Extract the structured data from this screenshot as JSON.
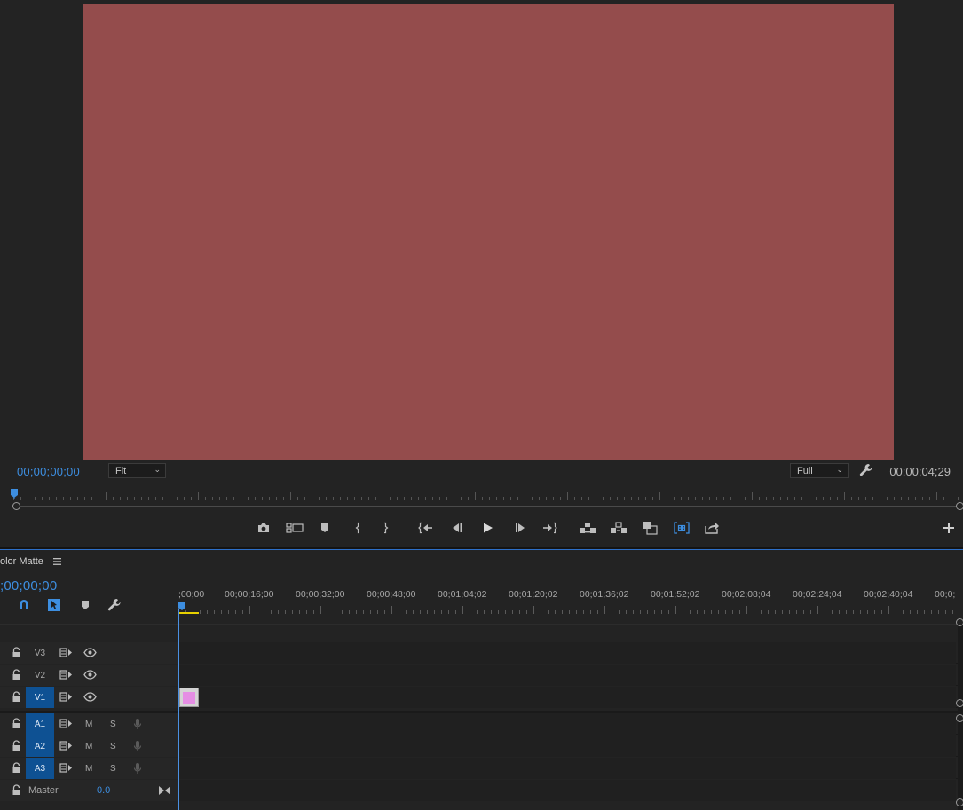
{
  "colors": {
    "accent": "#3d8ee0",
    "video_frame": "#944c4c",
    "track_target": "#0e5193",
    "clip_thumbnail": "#e58ee4",
    "work_area": "#e7d000"
  },
  "program_monitor": {
    "current_timecode": "00;00;00;00",
    "duration_timecode": "00;00;04;29",
    "zoom_level": "Fit",
    "playback_resolution": "Full",
    "transport_buttons": [
      "camera-icon",
      "multicam-icon",
      "marker-icon",
      "mark-in-icon",
      "mark-out-icon",
      "go-to-in-icon",
      "step-back-icon",
      "play-icon",
      "step-forward-icon",
      "go-to-out-icon",
      "lift-icon",
      "extract-icon",
      "comparison-view-icon",
      "trim-icon",
      "export-frame-icon"
    ]
  },
  "timeline": {
    "sequence_name": "olor Matte",
    "current_timecode": ";00;00;00",
    "time_labels": [
      ";00;00",
      "00;00;16;00",
      "00;00;32;00",
      "00;00;48;00",
      "00;01;04;02",
      "00;01;20;02",
      "00;01;36;02",
      "00;01;52;02",
      "00;02;08;04",
      "00;02;24;04",
      "00;02;40;04",
      "00;0;"
    ],
    "video_tracks": [
      {
        "name": "V3",
        "targeted": false,
        "has_clip": false
      },
      {
        "name": "V2",
        "targeted": false,
        "has_clip": false
      },
      {
        "name": "V1",
        "targeted": true,
        "has_clip": true
      }
    ],
    "audio_tracks": [
      {
        "name": "A1",
        "targeted": true,
        "mute": "M",
        "solo": "S"
      },
      {
        "name": "A2",
        "targeted": true,
        "mute": "M",
        "solo": "S"
      },
      {
        "name": "A3",
        "targeted": true,
        "mute": "M",
        "solo": "S"
      }
    ],
    "master": {
      "label": "Master",
      "volume": "0.0"
    }
  }
}
